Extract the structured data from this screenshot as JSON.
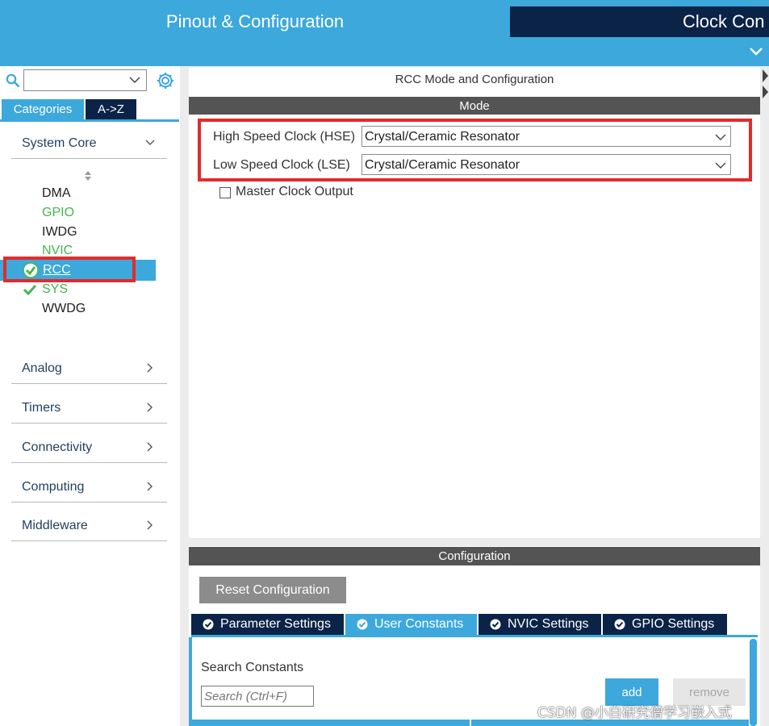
{
  "header": {
    "tab_pinout": "Pinout & Configuration",
    "tab_clock": "Clock Con"
  },
  "left_panel": {
    "search": {
      "value": "",
      "placeholder": ""
    },
    "category_tabs": [
      "Categories",
      "A->Z"
    ],
    "system_core": {
      "label": "System Core",
      "items": [
        {
          "label": "DMA",
          "status": "none"
        },
        {
          "label": "GPIO",
          "status": "configured"
        },
        {
          "label": "IWDG",
          "status": "none"
        },
        {
          "label": "NVIC",
          "status": "configured"
        },
        {
          "label": "RCC",
          "status": "selected"
        },
        {
          "label": "SYS",
          "status": "ok"
        },
        {
          "label": "WWDG",
          "status": "none"
        }
      ]
    },
    "categories": [
      "Analog",
      "Timers",
      "Connectivity",
      "Computing",
      "Middleware"
    ]
  },
  "mode_panel": {
    "title": "RCC Mode and Configuration",
    "section": "Mode",
    "hse": {
      "label": "High Speed Clock (HSE)",
      "value": "Crystal/Ceramic Resonator"
    },
    "lse": {
      "label": "Low Speed Clock (LSE)",
      "value": "Crystal/Ceramic Resonator"
    },
    "master_clock_output": {
      "label": "Master Clock Output",
      "checked": false
    }
  },
  "config_panel": {
    "section": "Configuration",
    "reset_button": "Reset Configuration",
    "tabs": [
      {
        "label": "Parameter Settings",
        "active": false
      },
      {
        "label": "User Constants",
        "active": true
      },
      {
        "label": "NVIC Settings",
        "active": false
      },
      {
        "label": "GPIO Settings",
        "active": false
      }
    ],
    "search_label": "Search Constants",
    "search_placeholder": "Search (Ctrl+F)",
    "add_button": "add",
    "remove_button": "remove"
  },
  "watermark": "CSDN @小白研究僧学习嵌入式",
  "colors": {
    "accent": "#3ca8dc",
    "navy": "#0c2348",
    "configured_green": "#42b84a",
    "highlight_red": "#e42a2a",
    "section_bar": "#545454"
  }
}
